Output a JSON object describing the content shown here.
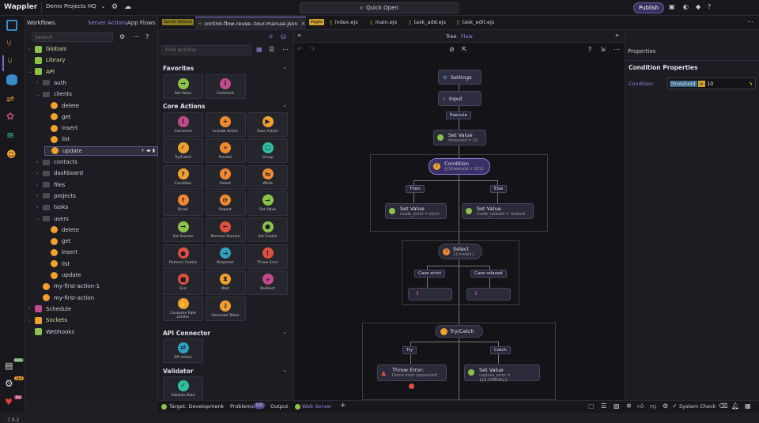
{
  "app": {
    "title": "Wappler",
    "project": "Demo Projects HQ",
    "quick_open": "Quick Open",
    "publish": "Publish",
    "version": "7.9.2"
  },
  "left": {
    "tab_workflows": "Workflows",
    "tab_server_actions": "Server Actions",
    "tab_app_flows": "App Flows",
    "search_placeholder": "Search",
    "items": [
      {
        "label": "Globals",
        "kind": "db"
      },
      {
        "label": "Library",
        "kind": "lib"
      },
      {
        "label": "API",
        "kind": "api"
      },
      {
        "label": "auth",
        "kind": "folder"
      },
      {
        "label": "clients",
        "kind": "folder"
      },
      {
        "label": "delete",
        "kind": "action"
      },
      {
        "label": "get",
        "kind": "action"
      },
      {
        "label": "insert",
        "kind": "action"
      },
      {
        "label": "list",
        "kind": "action"
      },
      {
        "label": "update",
        "kind": "action"
      },
      {
        "label": "contacts",
        "kind": "folder"
      },
      {
        "label": "dashboard",
        "kind": "folder"
      },
      {
        "label": "files",
        "kind": "folder"
      },
      {
        "label": "projects",
        "kind": "folder"
      },
      {
        "label": "tasks",
        "kind": "folder"
      },
      {
        "label": "users",
        "kind": "folder"
      },
      {
        "label": "delete",
        "kind": "action"
      },
      {
        "label": "get",
        "kind": "action"
      },
      {
        "label": "insert",
        "kind": "action"
      },
      {
        "label": "list",
        "kind": "action"
      },
      {
        "label": "update",
        "kind": "action"
      },
      {
        "label": "my-first-action-1",
        "kind": "action"
      },
      {
        "label": "my-first-action",
        "kind": "action"
      },
      {
        "label": "Schedule",
        "kind": "schedule"
      },
      {
        "label": "Sockets",
        "kind": "socket"
      },
      {
        "label": "Webhooks",
        "kind": "webhook"
      }
    ]
  },
  "tabs": {
    "badge_server": "Server Actions",
    "active": "control-flow-reuse--tour-manual.json",
    "badge_pages": "Pages",
    "t1": "index.ejs",
    "t2": "main.ejs",
    "t3": "task_add.ejs",
    "t4": "task_edit.ejs"
  },
  "actions": {
    "search_placeholder": "Find Actions",
    "favorites": "Favorites",
    "core": "Core Actions",
    "api_connector": "API Connector",
    "validator": "Validator",
    "fav": [
      {
        "label": "Set Value",
        "color": "#8bc34a",
        "glyph": "→"
      },
      {
        "label": "Comment",
        "color": "#c04a8a",
        "glyph": "i"
      }
    ],
    "core_items": [
      {
        "label": "Comment",
        "color": "#c04a8a",
        "glyph": "i"
      },
      {
        "label": "Include Action",
        "color": "#f08a30",
        "glyph": "+"
      },
      {
        "label": "Exec Action",
        "color": "#f0a030",
        "glyph": "▶"
      },
      {
        "label": "Try/Catch",
        "color": "#f0a030",
        "glyph": "✓"
      },
      {
        "label": "Parallel",
        "color": "#f08a30",
        "glyph": "»"
      },
      {
        "label": "Group",
        "color": "#30c0a0",
        "glyph": "□"
      },
      {
        "label": "Condition",
        "color": "#f0a030",
        "glyph": "?"
      },
      {
        "label": "Select",
        "color": "#f08a30",
        "glyph": "?"
      },
      {
        "label": "While",
        "color": "#f08a30",
        "glyph": "⇆"
      },
      {
        "label": "Break",
        "color": "#f08a30",
        "glyph": "↑"
      },
      {
        "label": "Repeat",
        "color": "#f08a30",
        "glyph": "⟳"
      },
      {
        "label": "Set Value",
        "color": "#8bc34a",
        "glyph": "→"
      },
      {
        "label": "Set Session",
        "color": "#8bc34a",
        "glyph": "→"
      },
      {
        "label": "Remove Session",
        "color": "#e05040",
        "glyph": "←"
      },
      {
        "label": "Set Cookie",
        "color": "#8bc34a",
        "glyph": "●"
      },
      {
        "label": "Remove Cookie",
        "color": "#e05040",
        "glyph": "●"
      },
      {
        "label": "Response",
        "color": "#30a0c0",
        "glyph": "→"
      },
      {
        "label": "Throw Error",
        "color": "#e05040",
        "glyph": "!"
      },
      {
        "label": "End",
        "color": "#e05040",
        "glyph": "■"
      },
      {
        "label": "Wait",
        "color": "#f0a030",
        "glyph": "⧗"
      },
      {
        "label": "Redirect",
        "color": "#c04a8a",
        "glyph": "»"
      },
      {
        "label": "Consume Rate Limiter",
        "color": "#f0a030",
        "glyph": "✋"
      },
      {
        "label": "Generate Token",
        "color": "#f0a030",
        "glyph": "⚷"
      }
    ],
    "api_items": [
      {
        "label": "API Action",
        "color": "#30a0c0",
        "glyph": "⇄"
      }
    ],
    "val_items": [
      {
        "label": "Validate Data",
        "color": "#30c0a0",
        "glyph": "✓"
      }
    ]
  },
  "canvas": {
    "view_tree": "Tree",
    "view_flow": "Flow",
    "settings": "Settings",
    "input": "Input",
    "execute": "Execute",
    "setvalue1": {
      "title": "Set Value",
      "sub": "threshold = 10"
    },
    "condition": {
      "title": "Condition",
      "sub": "{{threshold > 10}}"
    },
    "then": "Then",
    "else": "Else",
    "sv_strict": {
      "title": "Set Value",
      "sub": "mode_strict = strict"
    },
    "sv_relaxed": {
      "title": "Set Value",
      "sub": "mode_relaxed = relaxed"
    },
    "select": {
      "title": "Select",
      "sub": "{{mode}}"
    },
    "case_strict": "Case strict",
    "case_relaxed": "Case relaxed",
    "trycatch": "Try/Catch",
    "try": "Try",
    "catch": "Catch",
    "throw": {
      "title": "Throw Error:",
      "sub": "Demo error (expected)"
    },
    "sv_error": {
      "title": "Set Value",
      "sub": "capture_error = {{$_ERROR}}"
    }
  },
  "props": {
    "header": "Properties",
    "title": "Condition Properties",
    "field_label": "Condition",
    "field_value": "threshold",
    "op": ">",
    "num": "10"
  },
  "status": {
    "target": "Target: Development",
    "problems": "Problems",
    "problems_count": "0/0",
    "output": "Output",
    "web_server": "Web Server",
    "system_check": "System Check"
  }
}
